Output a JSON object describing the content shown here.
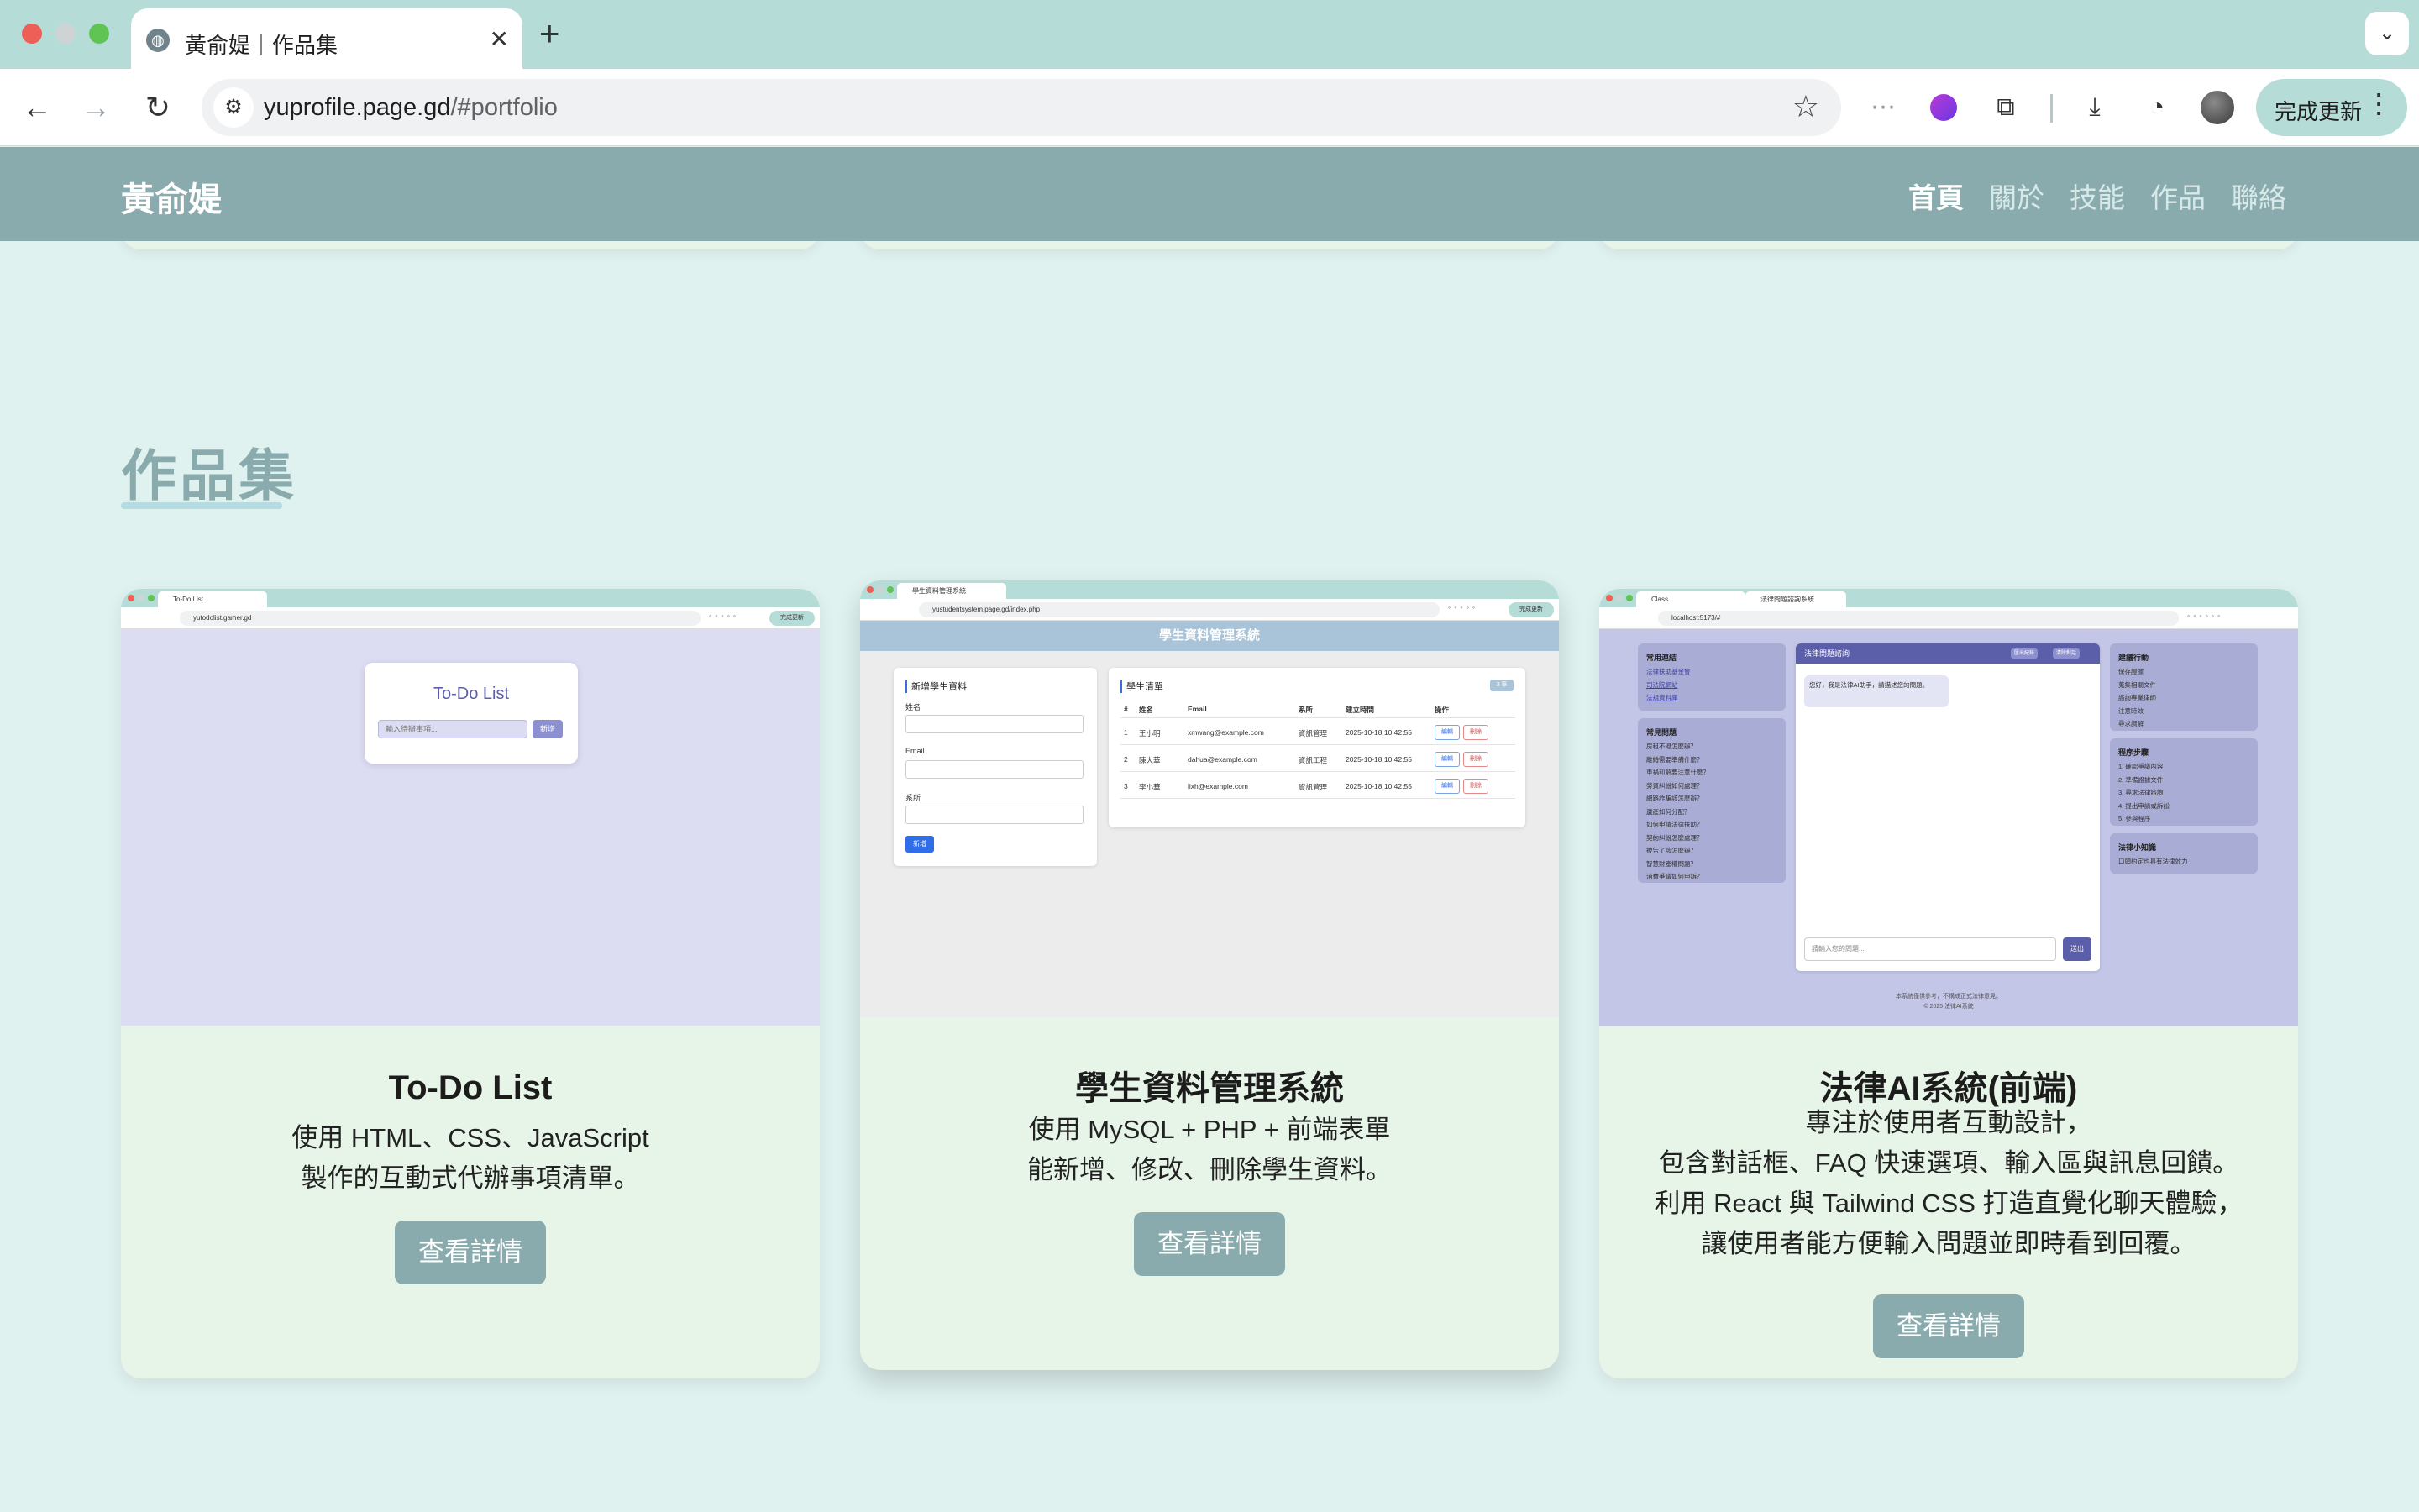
{
  "browser": {
    "tab_title": "黃俞媞｜作品集",
    "url_host": "yuprofile.page.gd",
    "url_path": "/#portfolio",
    "update_label": "完成更新"
  },
  "site": {
    "brand": "黃俞媞",
    "nav": [
      "首頁",
      "關於",
      "技能",
      "作品",
      "聯絡"
    ],
    "active_nav": "首頁"
  },
  "section": {
    "title": "作品集"
  },
  "projects": [
    {
      "title": "To-Do List",
      "desc_lines": [
        "使用 HTML、CSS、JavaScript",
        "製作的互動式代辦事項清單。"
      ],
      "button": "查看詳情",
      "thumb": {
        "tab": "To-Do List",
        "url": "yutodolist.gamer.gd",
        "update": "完成更新",
        "app_title": "To-Do List",
        "placeholder": "輸入待辦事項...",
        "add": "新增"
      }
    },
    {
      "title": "學生資料管理系統",
      "desc_lines": [
        "使用 MySQL + PHP + 前端表單",
        "能新增、修改、刪除學生資料。"
      ],
      "button": "查看詳情",
      "thumb": {
        "tab": "學生資料管理系統",
        "url": "yustudentsystem.page.gd/index.php",
        "update": "完成更新",
        "header": "學生資料管理系統",
        "form_title": "新增學生資料",
        "labels": [
          "姓名",
          "Email",
          "系所"
        ],
        "add": "新增",
        "list_title": "學生清單",
        "badge": "3 筆",
        "columns": [
          "#",
          "姓名",
          "Email",
          "系所",
          "建立時間",
          "操作"
        ],
        "rows": [
          [
            "1",
            "王小明",
            "xmwang@example.com",
            "資訊管理",
            "2025-10-18 10:42:55"
          ],
          [
            "2",
            "陳大華",
            "dahua@example.com",
            "資訊工程",
            "2025-10-18 10:42:55"
          ],
          [
            "3",
            "李小華",
            "lixh@example.com",
            "資訊管理",
            "2025-10-18 10:42:55"
          ]
        ],
        "edit": "編輯",
        "delete": "刪除"
      }
    },
    {
      "title": "法律AI系統(前端)",
      "desc_lines": [
        "專注於使用者互動設計，",
        "包含對話框、FAQ 快速選項、輸入區與訊息回饋。",
        "利用 React 與 Tailwind CSS 打造直覺化聊天體驗，",
        "讓使用者能方便輸入問題並即時看到回覆。"
      ],
      "button": "查看詳情",
      "thumb": {
        "tab1": "Class",
        "tab2": "法律問題諮詢系統",
        "url": "localhost:5173/#",
        "chat_title": "法律問題諮詢",
        "chips": [
          "匯出紀錄",
          "清除對話"
        ],
        "greeting": "您好，我是法律AI助手，請描述您的問題。",
        "placeholder": "請輸入您的問題...",
        "send": "送出",
        "left_top_title": "常用連結",
        "left_top_items": [
          "法律扶助基金會",
          "司法院網站",
          "法規資料庫"
        ],
        "left_bottom_title": "常見問題",
        "left_bottom_items": [
          "房租不退怎麼辦？",
          "離婚需要準備什麼？",
          "車禍和解要注意什麼？",
          "勞資糾紛如何處理？",
          "網路詐騙該怎麼辦？",
          "遺產如何分配？",
          "如何申請法律扶助？",
          "契約糾紛怎麼處理？",
          "被告了該怎麼辦？",
          "智慧財產權問題？",
          "消費爭議如何申訴？"
        ],
        "right1_title": "建議行動",
        "right1_items": [
          "保存證據",
          "蒐集相關文件",
          "諮詢專業律師",
          "注意時效",
          "尋求調解"
        ],
        "right2_title": "程序步驟",
        "right2_items": [
          "1. 確認爭議內容",
          "2. 準備證據文件",
          "3. 尋求法律諮詢",
          "4. 提出申請或訴訟",
          "5. 參與程序"
        ],
        "right3_title": "法律小知識",
        "right3_items": [
          "口頭約定也具有法律效力"
        ],
        "footer": [
          "本系統僅供參考，不構成正式法律意見。",
          "© 2025 法律AI系統"
        ]
      }
    }
  ]
}
